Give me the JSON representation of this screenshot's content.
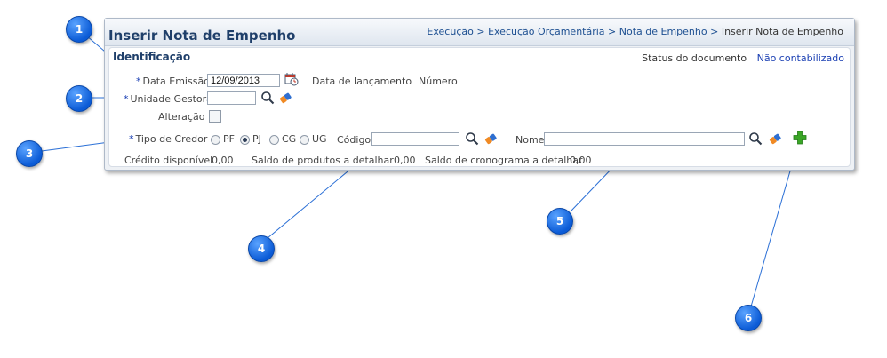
{
  "page": {
    "title": "Inserir Nota de Empenho",
    "breadcrumb": {
      "items": [
        "Execução",
        "Execução Orçamentária",
        "Nota de Empenho"
      ],
      "current": "Inserir Nota de Empenho",
      "separator": ">"
    }
  },
  "identificacao": {
    "title": "Identificação",
    "status_label": "Status do documento",
    "status_value": "Não contabilizado",
    "required_mark": "*",
    "data_emissao_label": "Data Emissão",
    "data_emissao_value": "12/09/2013",
    "data_lancamento_label": "Data de lançamento",
    "numero_label": "Número",
    "unidade_gestora_label": "Unidade Gestora",
    "unidade_gestora_value": "",
    "alteracao_label": "Alteração",
    "tipo_credor_label": "Tipo de Credor",
    "tipo_credor_options": [
      "PF",
      "PJ",
      "CG",
      "UG"
    ],
    "tipo_credor_selected": "PJ",
    "codigo_label": "Código",
    "codigo_value": "",
    "nome_label": "Nome",
    "nome_value": "",
    "credito_disponivel_label": "Crédito disponível",
    "credito_disponivel_value": "0,00",
    "saldo_produtos_label": "Saldo de produtos a detalhar",
    "saldo_produtos_value": "0,00",
    "saldo_cronograma_label": "Saldo de cronograma a detalhar",
    "saldo_cronograma_value": "0,00"
  },
  "callouts": [
    "1",
    "2",
    "3",
    "4",
    "5",
    "6"
  ],
  "colors": {
    "title": "#1f3f6a",
    "link": "#1d4f91",
    "status_value": "#1a3fb3",
    "callout": "#0b5bd6",
    "add_icon": "#3aa626"
  },
  "icons": [
    "calendar-icon",
    "search-icon",
    "eraser-icon",
    "add-icon"
  ]
}
